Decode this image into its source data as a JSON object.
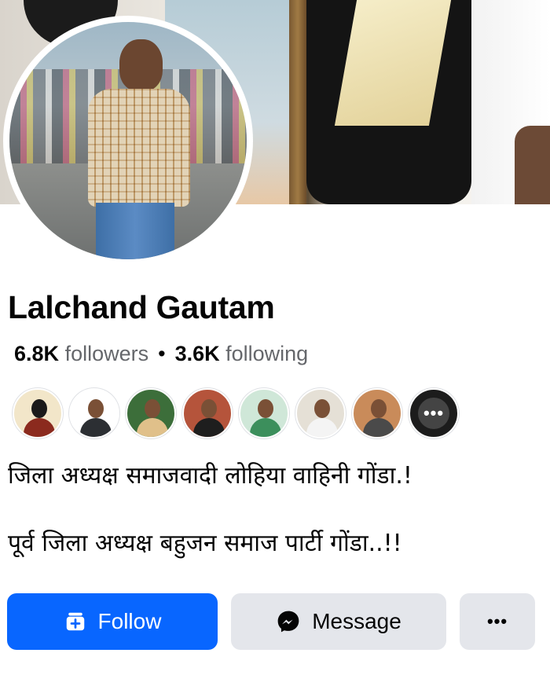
{
  "profile": {
    "name": "Lalchand Gautam",
    "followers_count": "6.8K",
    "followers_label": "followers",
    "separator": "•",
    "following_count": "3.6K",
    "following_label": "following"
  },
  "mutual_friends": {
    "more_label": "•••",
    "avatar_colors": [
      "#8b2a1e",
      "#e7e3df",
      "#3c6e3a",
      "#b5543b",
      "#3c8f5c",
      "#e5e0d6",
      "#c98b5a"
    ]
  },
  "bio": {
    "line1": "जिला अध्यक्ष समाजवादी लोहिया वाहिनी गोंडा.!",
    "line2": "पूर्व जिला अध्यक्ष बहुजन समाज पार्टी गोंडा..!!"
  },
  "actions": {
    "follow_label": "Follow",
    "message_label": "Message",
    "more_label": "•••"
  },
  "colors": {
    "primary": "#0866ff",
    "secondary_button": "#e4e6eb",
    "muted_text": "#65676b"
  }
}
